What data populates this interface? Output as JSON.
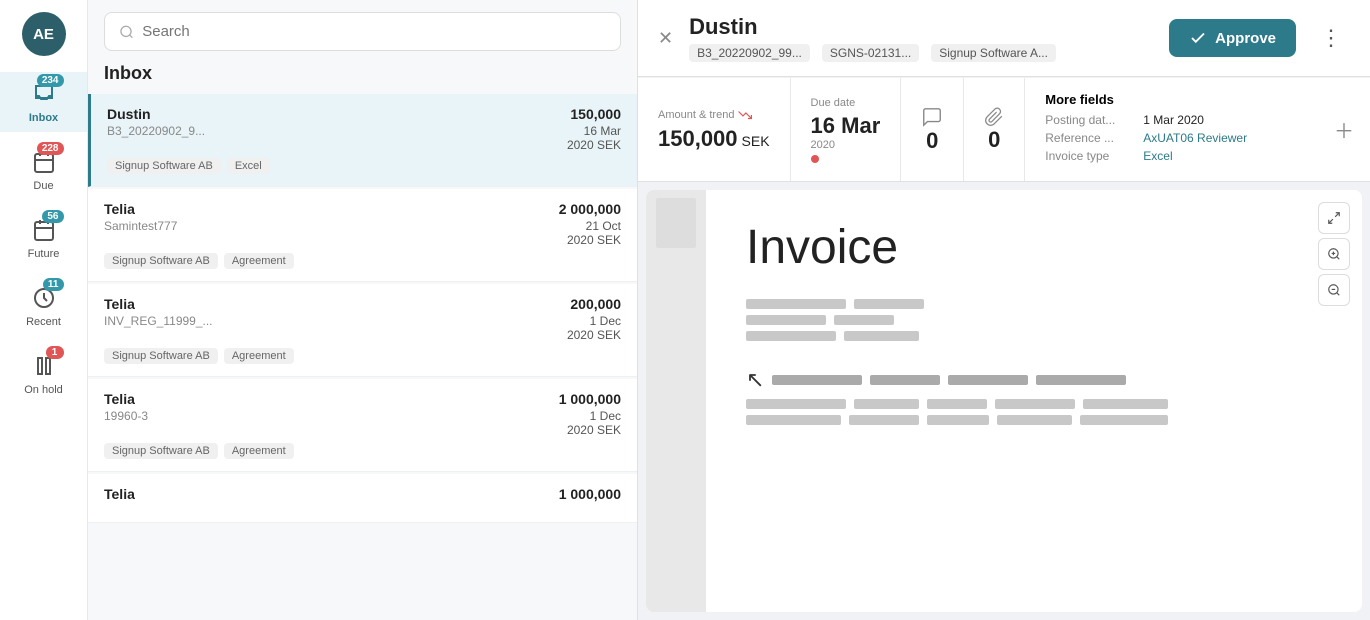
{
  "sidebar": {
    "avatar": {
      "initials": "AE"
    },
    "nav_items": [
      {
        "id": "inbox",
        "label": "Inbox",
        "badge": "234",
        "badge_type": "blue",
        "active": true,
        "icon": "inbox"
      },
      {
        "id": "due",
        "label": "Due",
        "badge": "228",
        "badge_type": "red",
        "active": false,
        "icon": "calendar-due"
      },
      {
        "id": "future",
        "label": "Future",
        "badge": "56",
        "badge_type": "blue",
        "active": false,
        "icon": "calendar-future"
      },
      {
        "id": "recent",
        "label": "Recent",
        "badge": "11",
        "badge_type": "blue",
        "active": false,
        "icon": "clock"
      },
      {
        "id": "on_hold",
        "label": "On hold",
        "badge": "1",
        "badge_type": "red",
        "active": false,
        "icon": "pause"
      }
    ]
  },
  "left_panel": {
    "search_placeholder": "Search",
    "inbox_title": "Inbox",
    "invoices": [
      {
        "name": "Dustin",
        "ref": "B3_20220902_9...",
        "date": "16 Mar",
        "year": "2020",
        "amount": "150,000",
        "currency": "SEK",
        "tags": [
          "Signup Software AB",
          "Excel"
        ],
        "active": true
      },
      {
        "name": "Telia",
        "ref": "Samintest777",
        "date": "21 Oct",
        "year": "2020",
        "amount": "2 000,000",
        "currency": "SEK",
        "tags": [
          "Signup Software AB",
          "Agreement"
        ],
        "active": false
      },
      {
        "name": "Telia",
        "ref": "INV_REG_11999_...",
        "date": "1 Dec",
        "year": "2020",
        "amount": "200,000",
        "currency": "SEK",
        "tags": [
          "Signup Software AB",
          "Agreement"
        ],
        "active": false
      },
      {
        "name": "Telia",
        "ref": "19960-3",
        "date": "1 Dec",
        "year": "2020",
        "amount": "1 000,000",
        "currency": "SEK",
        "tags": [
          "Signup Software AB",
          "Agreement"
        ],
        "active": false
      },
      {
        "name": "Telia",
        "ref": "",
        "date": "",
        "year": "",
        "amount": "1 000,000",
        "currency": "",
        "tags": [],
        "active": false
      }
    ]
  },
  "right_panel": {
    "header": {
      "title": "Dustin",
      "meta_tags": [
        "B3_20220902_99...",
        "SGNS-02131...",
        "Signup Software A..."
      ],
      "approve_label": "Approve",
      "more_label": "..."
    },
    "info_bar": {
      "amount_label": "Amount & trend",
      "amount_value": "150,000",
      "amount_currency": "SEK",
      "due_date_label": "Due date",
      "due_date_value": "16 Mar",
      "due_date_year": "2020",
      "comments_count": "0",
      "attachments_count": "0",
      "more_fields_label": "More fields",
      "posting_date_label": "Posting dat...",
      "posting_date_value": "1 Mar 2020",
      "reference_label": "Reference ...",
      "reference_value": "AxUAT06 Reviewer",
      "invoice_type_label": "Invoice type",
      "invoice_type_value": "Excel"
    },
    "document": {
      "title": "Invoice"
    }
  }
}
